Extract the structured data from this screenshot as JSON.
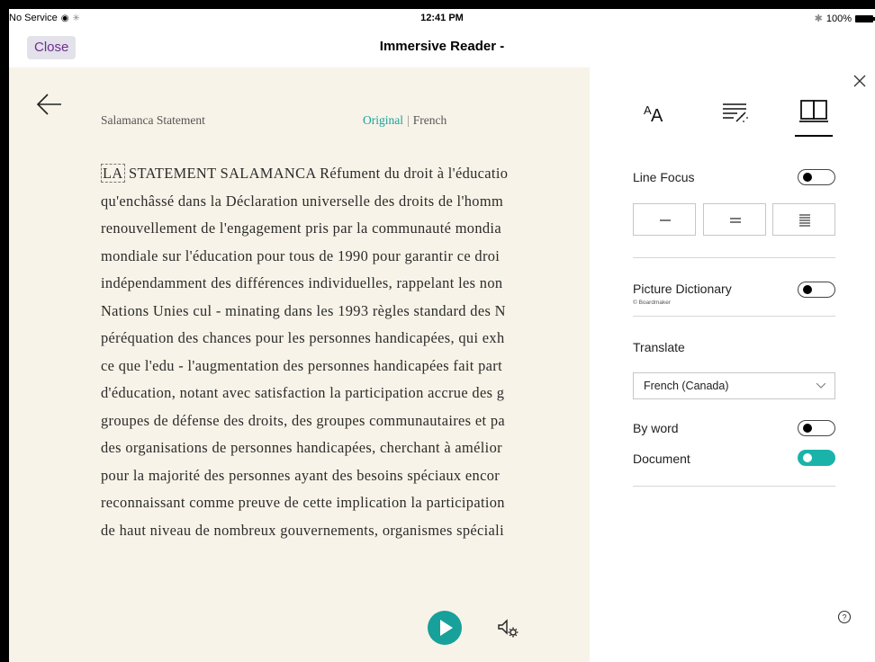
{
  "status_bar": {
    "carrier": "No Service",
    "time": "12:41 PM",
    "battery": "100%"
  },
  "nav": {
    "close_label": "Close",
    "title": "Immersive Reader -"
  },
  "reader": {
    "doc_title": "Salamanca Statement",
    "lang_original": "Original",
    "lang_separator": "|",
    "lang_translated": "French",
    "first_word": "LA",
    "lines": [
      " STATEMENT SALAMANCA Réfument du droit à l'éducatio",
      "qu'enchâssé dans la Déclaration universelle des droits de l'homm",
      "renouvellement de l'engagement pris par la communauté mondia",
      "mondiale sur l'éducation pour tous de 1990 pour garantir ce droi",
      "indépendamment des différences individuelles, rappelant les non",
      "Nations Unies cul - minating dans les 1993 règles standard des N",
      "péréquation des chances pour les personnes handicapées, qui exh",
      "ce que l'edu - l'augmentation des personnes handicapées fait part",
      "d'éducation, notant avec satisfaction la participation accrue des g",
      "groupes de défense des droits, des groupes communautaires et pa",
      "des organisations de personnes handicapées, cherchant à amélior",
      "pour la majorité des personnes ayant des besoins spéciaux encor",
      "reconnaissant comme preuve de cette implication la participation",
      "de haut niveau de nombreux gouvernements, organismes spéciali"
    ]
  },
  "panel": {
    "selected_tab": "reading-preferences",
    "line_focus_label": "Line Focus",
    "line_focus_on": false,
    "picture_dictionary_label": "Picture Dictionary",
    "picture_dictionary_credit": "© Boardmaker",
    "picture_dictionary_on": false,
    "translate_label": "Translate",
    "translate_language": "French (Canada)",
    "by_word_label": "By word",
    "by_word_on": false,
    "document_label": "Document",
    "document_on": true
  },
  "colors": {
    "accent": "#1ab3a9",
    "close_text": "#6d2e92",
    "reader_background": "#f8f3e8"
  }
}
